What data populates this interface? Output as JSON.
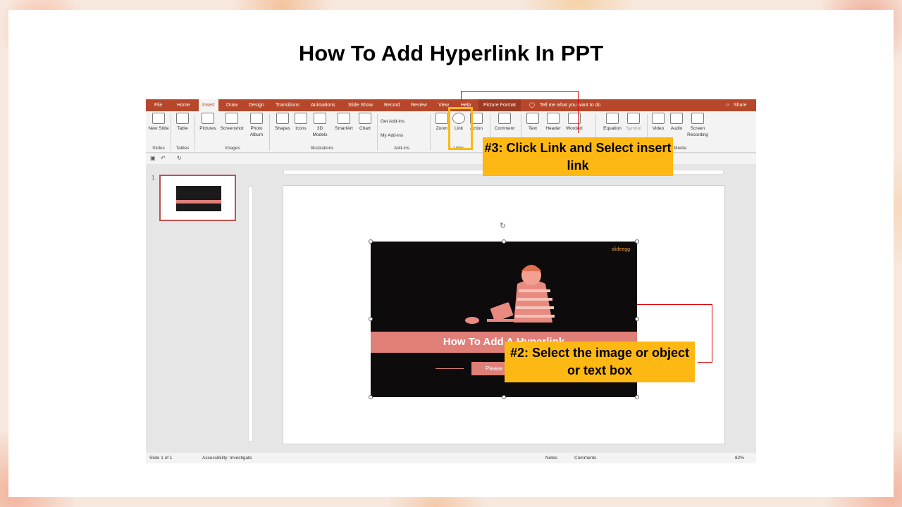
{
  "page_title": "How To Add Hyperlink In PPT",
  "app": {
    "tabs": [
      {
        "label": "File"
      },
      {
        "label": "Home"
      },
      {
        "label": "Insert",
        "active": true
      },
      {
        "label": "Draw"
      },
      {
        "label": "Design"
      },
      {
        "label": "Transitions"
      },
      {
        "label": "Animations"
      },
      {
        "label": "Slide Show"
      },
      {
        "label": "Record"
      },
      {
        "label": "Review"
      },
      {
        "label": "View"
      },
      {
        "label": "Help"
      },
      {
        "label": "Picture Format"
      }
    ],
    "tell_me": "Tell me what you want to do",
    "share": "Share",
    "ribbon": {
      "new_slide": "New Slide",
      "table": "Table",
      "pictures": "Pictures",
      "screenshot": "Screenshot",
      "photo_album": "Photo Album",
      "shapes": "Shapes",
      "icons": "Icons",
      "models_3d": "3D Models",
      "smartart": "SmartArt",
      "chart": "Chart",
      "get_addins": "Get Add-ins",
      "my_addins": "My Add-ins",
      "zoom": "Zoom",
      "link": "Link",
      "action": "Action",
      "comment": "Comment",
      "text": "Text",
      "header": "Header",
      "wordart": "WordArt",
      "equation": "Equation",
      "symbol": "Symbol",
      "video": "Video",
      "audio": "Audio",
      "screen_recording": "Screen Recording"
    },
    "groups": {
      "slides": "Slides",
      "tables": "Tables",
      "images": "Images",
      "illustrations": "Illustrations",
      "addins": "Add-ins",
      "links": "Links",
      "media": "Media"
    },
    "thumb_number": "1",
    "slide_image": {
      "logo": "slideegg",
      "title": "How To Add A Hyperlink",
      "button": "Please"
    },
    "status": {
      "slide_count": "Slide 1 of 1",
      "accessibility": "Accessibility: Investigate",
      "notes": "Notes",
      "comments": "Comments",
      "zoom": "82%"
    }
  },
  "callouts": {
    "step3": "#3: Click Link and Select insert link",
    "step2": "#2: Select the image or object or text box"
  },
  "colors": {
    "accent": "#b7472a",
    "callout": "#fdb813",
    "band": "#e07e78",
    "leader": "#e00000"
  }
}
